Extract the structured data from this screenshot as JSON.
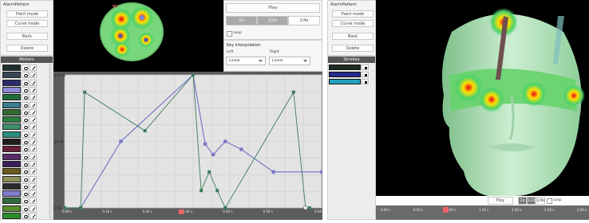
{
  "left_app": {
    "panel_title": "AlarmPattern",
    "buttons": {
      "paint_mode": "Paint mode",
      "curve_mode": "Curve mode",
      "back": "Back",
      "delete": "Delete"
    },
    "motors_header": "Motors",
    "motors": [
      {
        "color": "#1f2f2f"
      },
      {
        "color": "#3a4658"
      },
      {
        "color": "#2b2b6b"
      },
      {
        "color": "#8a8ad8"
      },
      {
        "color": "#1f6b3a"
      },
      {
        "color": "#3a7e8f"
      },
      {
        "color": "#2f6b2f"
      },
      {
        "color": "#2a7e3f"
      },
      {
        "color": "#3f8f6b"
      },
      {
        "color": "#2a8f7e"
      },
      {
        "color": "#1e1e1e"
      },
      {
        "color": "#6b1e3a"
      },
      {
        "color": "#5a2b6b"
      },
      {
        "color": "#3a1e5a"
      },
      {
        "color": "#6b5a1e"
      },
      {
        "color": "#8f8f5a"
      },
      {
        "color": "#2b2b2b"
      },
      {
        "color": "#7f7fd0"
      },
      {
        "color": "#2f6b3a"
      },
      {
        "color": "#5a8f2f"
      },
      {
        "color": "#2b8f2b"
      }
    ],
    "playback": {
      "play": "Play",
      "speeds": [
        "1x",
        "1/2x",
        "1/4x"
      ],
      "loop": "Loop"
    },
    "interp": {
      "title": "Key interpolation",
      "left_label": "Left",
      "right_label": "Right",
      "left_value": "Linear",
      "right_value": "Linear"
    },
    "chart_ylabels": [
      "100 %",
      "50 %",
      "0 %"
    ],
    "chart_xlabels": [
      "0.00 s",
      "0.10 s",
      "0.20 s",
      "0.30 s",
      "0.40 s",
      "0.50 s",
      "0.64 s"
    ]
  },
  "chart_data": {
    "type": "line",
    "xlim": [
      0,
      0.64
    ],
    "ylim": [
      0,
      100
    ],
    "series": [
      {
        "color": "#7a78c8",
        "x": [
          0,
          0.04,
          0.14,
          0.32,
          0.35,
          0.37,
          0.4,
          0.44,
          0.52,
          0.64
        ],
        "y": [
          0,
          0,
          50,
          100,
          48,
          40,
          50,
          44,
          27,
          27
        ]
      },
      {
        "color": "#3d7a5a",
        "x": [
          0,
          0.04,
          0.05,
          0.2,
          0.32,
          0.34,
          0.36,
          0.38,
          0.4,
          0.57,
          0.6,
          0.61
        ],
        "y": [
          0,
          0,
          87,
          58,
          100,
          13,
          27,
          13,
          0,
          87,
          0,
          0
        ]
      }
    ],
    "grid": true
  },
  "right_app": {
    "panel_title": "AlarmPattern",
    "buttons": {
      "paint_mode": "Paint mode",
      "curve_mode": "Curve mode",
      "back": "Back",
      "delete": "Delete"
    },
    "strokes_header": "Strokes",
    "strokes": [
      {
        "color": "#1e2e24"
      },
      {
        "color": "#262a8a"
      },
      {
        "color": "#24a0c0"
      }
    ],
    "playback": {
      "play": "Play",
      "speeds": [
        "1x",
        "1/2x",
        "1/4x"
      ],
      "loop": "Loop"
    },
    "timeline": [
      "0.00 s",
      "0.50 s",
      "1.00 s",
      "1.50 s",
      "2.00 s",
      "2.50 s",
      "3.00 s"
    ]
  }
}
